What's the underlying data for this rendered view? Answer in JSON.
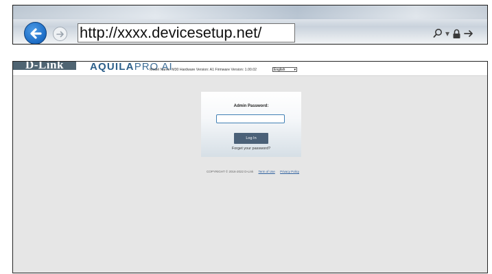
{
  "browser": {
    "url": "http://xxxx.devicesetup.net/",
    "icons": {
      "back": "back-arrow-icon",
      "forward": "forward-arrow-icon",
      "search": "search-icon",
      "dropdown": "chevron-down-icon",
      "lock": "lock-icon",
      "go": "go-arrow-icon"
    },
    "dropdown_glyph": "▾"
  },
  "router": {
    "logo": "D-Link",
    "product_bold": "AQUILA",
    "product_light": "PRO AI",
    "device_info": "Model Name: M30 Hardware Version: A1 Firmware Version: 1.00.02",
    "language": "English",
    "login": {
      "label": "Admin Password:",
      "password_value": "",
      "button": "Log In",
      "forgot": "Forget your password?"
    },
    "footer": {
      "copyright": "COPYRIGHT © 2016-2022 D-Link",
      "terms": "Term of Use",
      "privacy": "Privacy Policy"
    }
  },
  "colors": {
    "accent_blue": "#1f6fc7",
    "login_button": "#4b6178",
    "page_background": "#e6e6e6"
  }
}
